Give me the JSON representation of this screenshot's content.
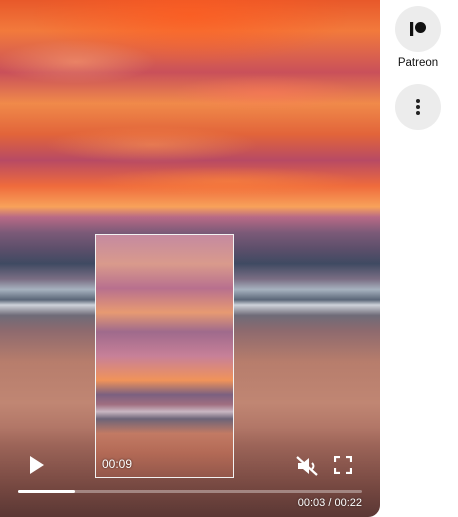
{
  "player": {
    "preview_time": "00:09",
    "current_time": "00:03",
    "total_time": "00:22",
    "time_display": "00:03 / 00:22",
    "progress": 0.165,
    "muted": true
  },
  "side": {
    "patreon_label": "Patreon"
  },
  "icons": {
    "play": "play-icon",
    "mute": "muted-speaker-icon",
    "fullscreen": "fullscreen-icon",
    "patreon": "patreon-icon",
    "more": "more-vertical-icon"
  },
  "colors": {
    "side_button_bg": "#ececec",
    "progress_fill": "#ffffff"
  }
}
